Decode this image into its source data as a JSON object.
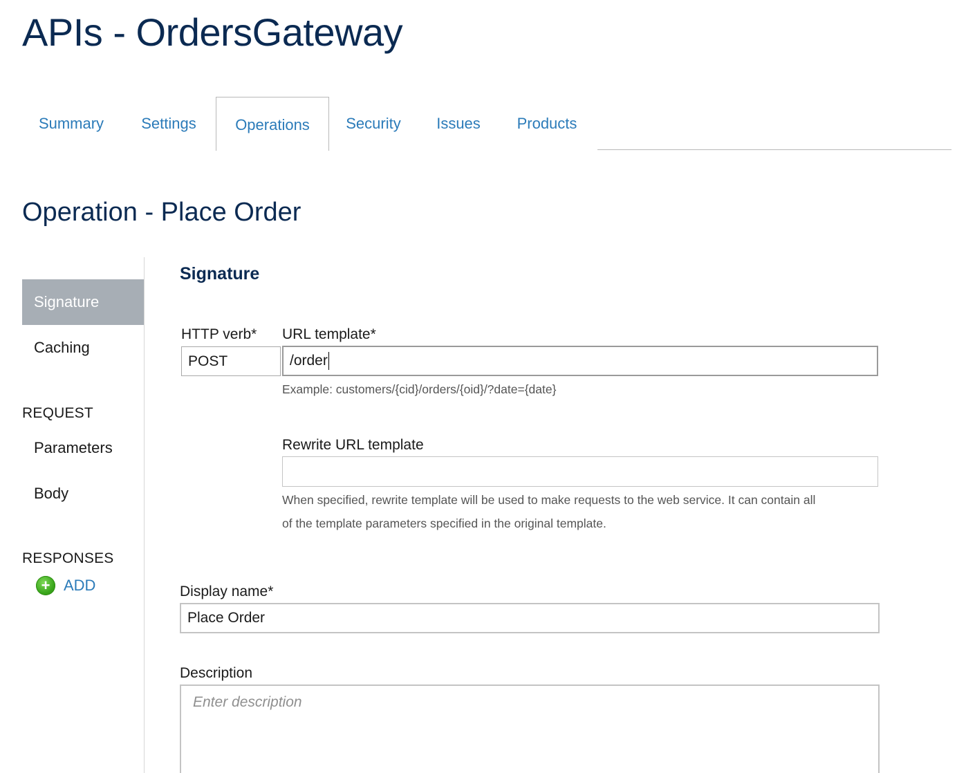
{
  "page": {
    "title": "APIs - OrdersGateway"
  },
  "tabs": [
    {
      "label": "Summary"
    },
    {
      "label": "Settings"
    },
    {
      "label": "Operations",
      "active": true
    },
    {
      "label": "Security"
    },
    {
      "label": "Issues"
    },
    {
      "label": "Products"
    }
  ],
  "operation": {
    "title": "Operation - Place Order"
  },
  "left_nav": {
    "items": [
      {
        "label": "Signature",
        "selected": true
      },
      {
        "label": "Caching"
      }
    ],
    "request_header": "REQUEST",
    "request_items": [
      {
        "label": "Parameters"
      },
      {
        "label": "Body"
      }
    ],
    "responses_header": "RESPONSES",
    "add_label": "ADD",
    "add_icon": "plus-circle-icon"
  },
  "form": {
    "section_title": "Signature",
    "http_verb": {
      "label": "HTTP verb*",
      "value": "POST"
    },
    "url_template": {
      "label": "URL template*",
      "value": "/order",
      "example": "Example: customers/{cid}/orders/{oid}/?date={date}"
    },
    "rewrite_url": {
      "label": "Rewrite URL template",
      "value": "",
      "hint_line1": "When specified, rewrite template will be used to make requests to the web service. It can contain all",
      "hint_line2": "of the template parameters specified in the original template."
    },
    "display_name": {
      "label": "Display name*",
      "value": "Place Order"
    },
    "description": {
      "label": "Description",
      "placeholder": "Enter description"
    }
  },
  "colors": {
    "title": "#0b2a52",
    "link": "#2b7bb9",
    "nav_selected_bg": "#a7aeb5",
    "add_green": "#3aa61b"
  }
}
